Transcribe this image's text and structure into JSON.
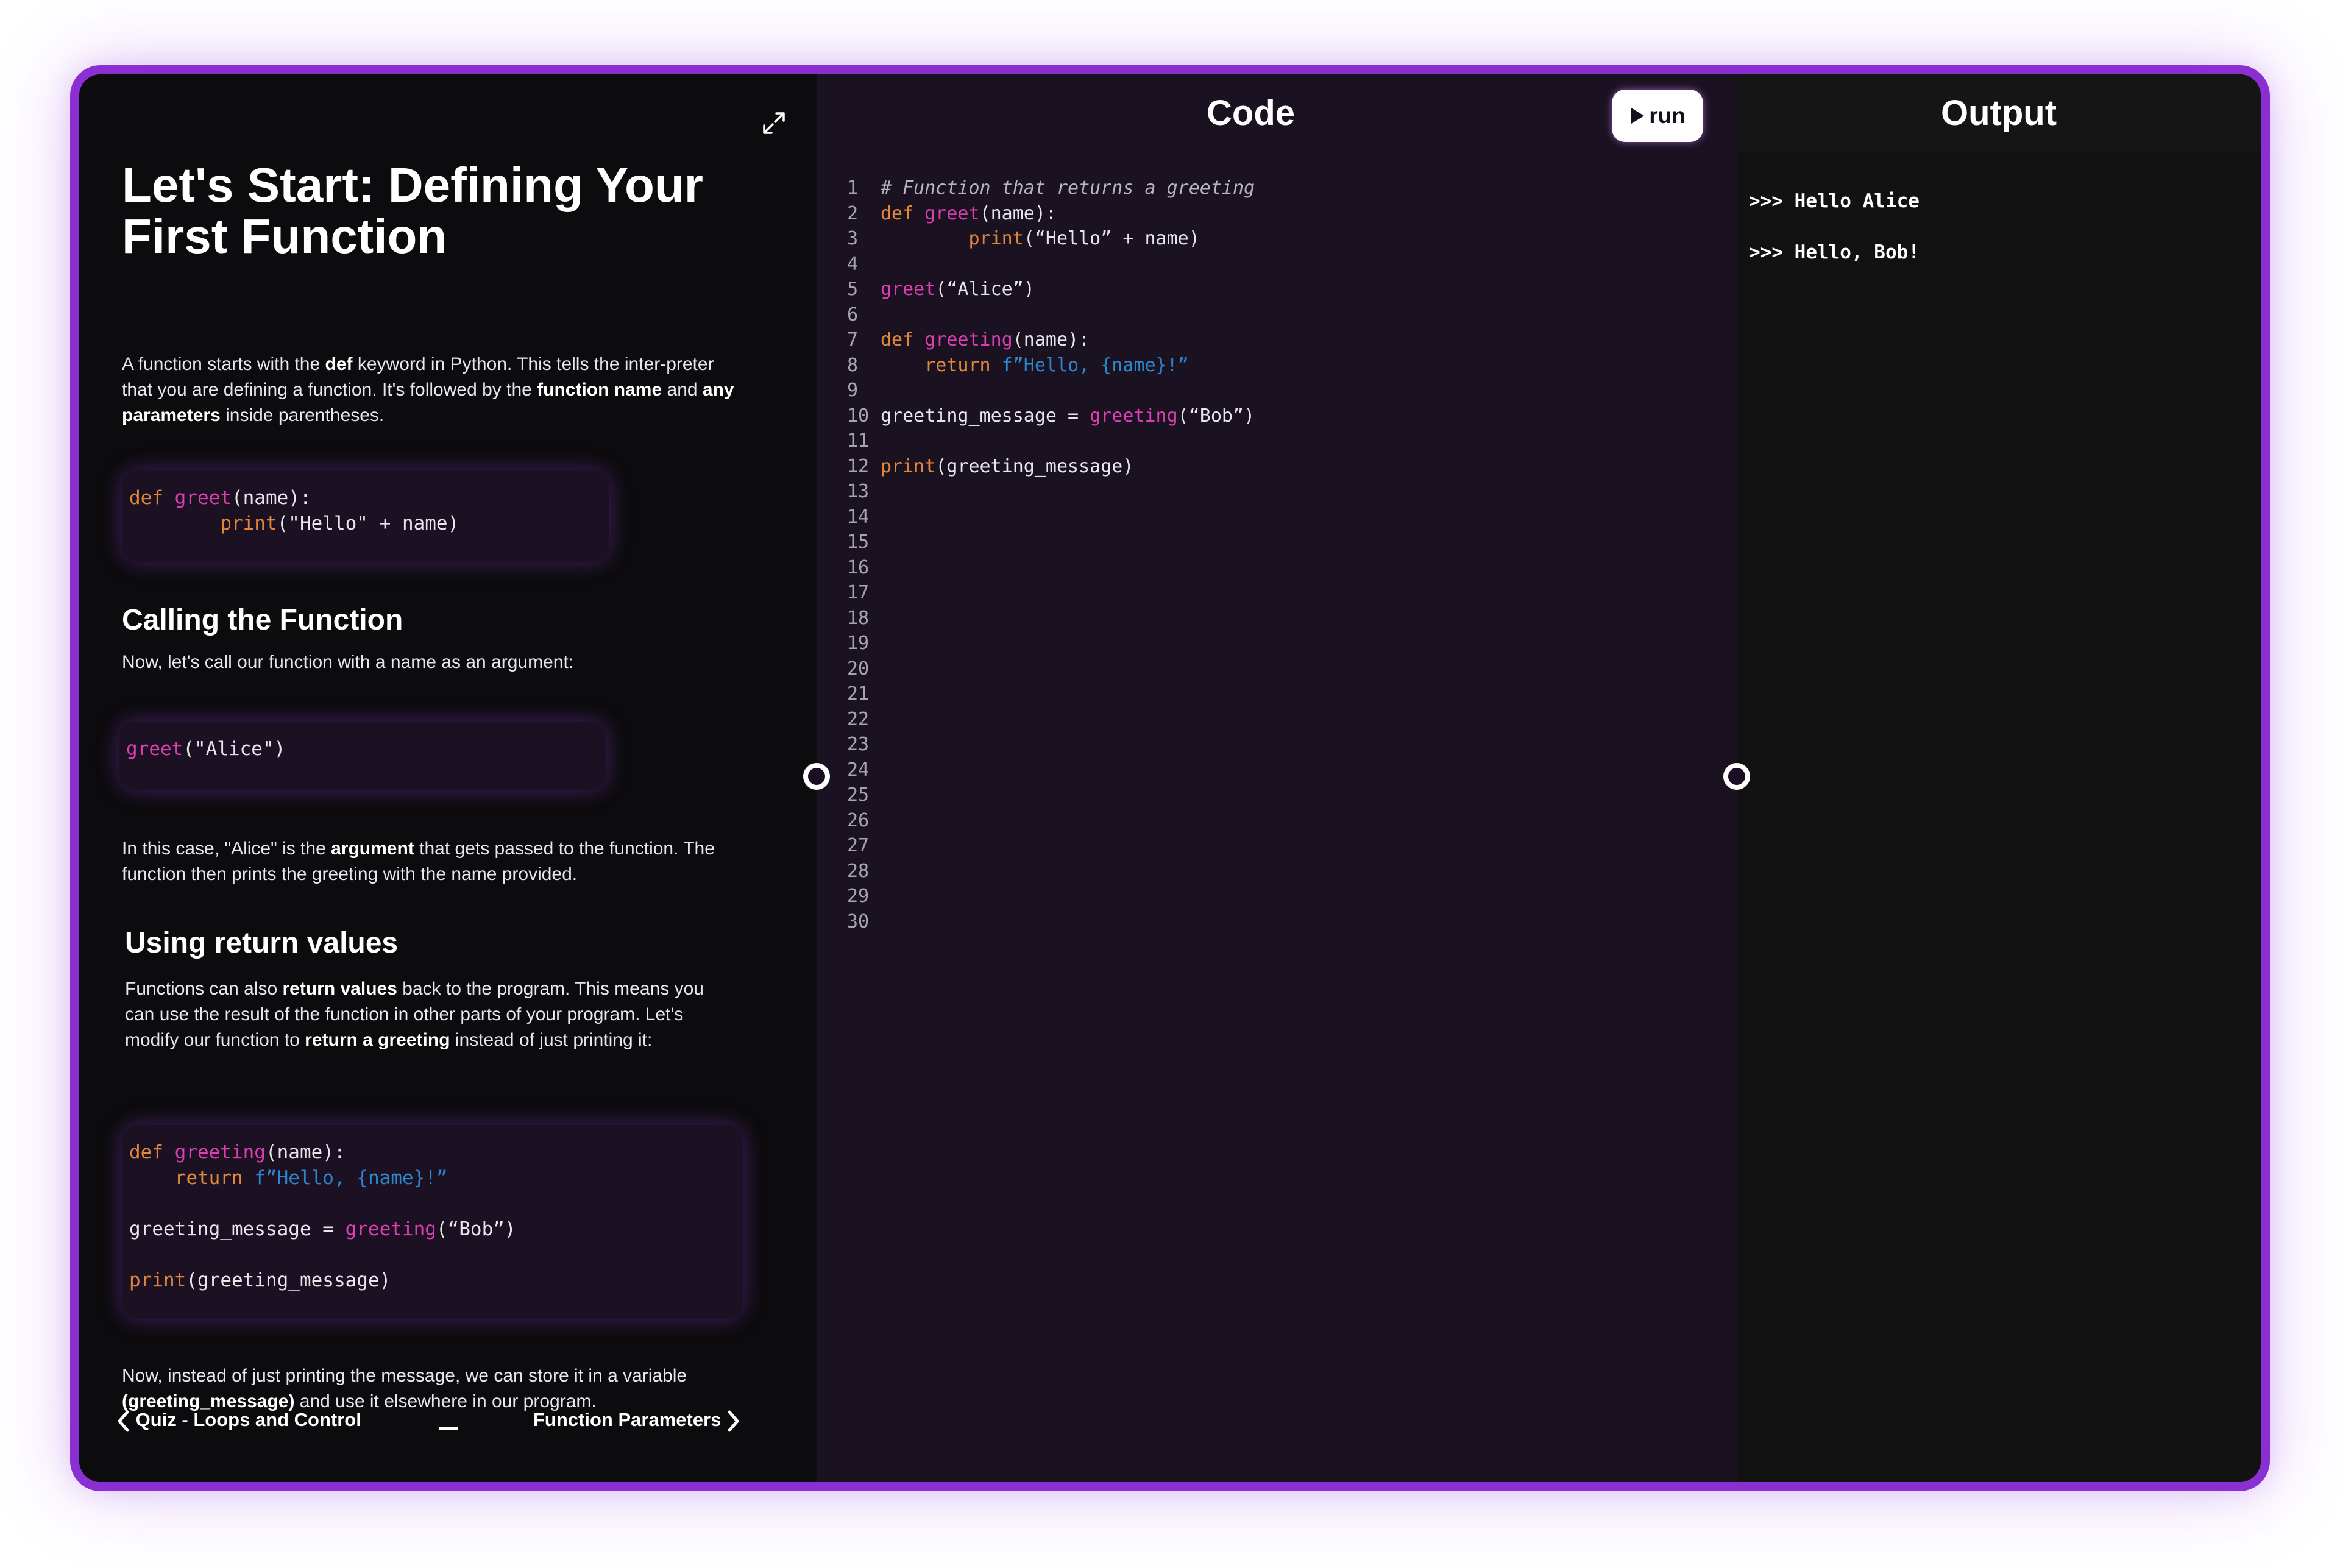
{
  "lesson": {
    "title": "Let's Start: Defining Your First Function",
    "intro": [
      {
        "t": "A function starts with the ",
        "b": false
      },
      {
        "t": "def",
        "b": true
      },
      {
        "t": " keyword in Python. This tells the inter-preter that you are defining a function. It's followed by the ",
        "b": false
      },
      {
        "t": "function name",
        "b": true
      },
      {
        "t": " and ",
        "b": false
      },
      {
        "t": "any parameters",
        "b": true
      },
      {
        "t": " inside parentheses.",
        "b": false
      }
    ],
    "section_call_title": "Calling the Function",
    "call_text": "Now, let's call our function with a name as an argument:",
    "argument_text": [
      {
        "t": "In this case, \"Alice\" is the ",
        "b": false
      },
      {
        "t": "argument",
        "b": true
      },
      {
        "t": " that gets passed to the function. The function then prints the greeting with the name provided.",
        "b": false
      }
    ],
    "section_return_title": "Using return values",
    "return_text": [
      {
        "t": "Functions can also ",
        "b": false
      },
      {
        "t": "return values",
        "b": true
      },
      {
        "t": " back to the program. This means you can use the result of the function in other parts of your program. Let's modify our function to ",
        "b": false
      },
      {
        "t": "return a greeting",
        "b": true
      },
      {
        "t": " instead of just printing it:",
        "b": false
      }
    ],
    "store_text": [
      {
        "t": "Now, instead of just printing the message, we can store it in a variable ",
        "b": false
      },
      {
        "t": "(greeting_message)",
        "b": true
      },
      {
        "t": " and use it elsewhere in our program.",
        "b": false
      }
    ],
    "snippet1": [
      [
        {
          "c": "kw",
          "t": "def "
        },
        {
          "c": "fn",
          "t": "greet"
        },
        {
          "c": "",
          "t": "(name):"
        }
      ],
      [
        {
          "c": "",
          "t": "        "
        },
        {
          "c": "kw",
          "t": "print"
        },
        {
          "c": "",
          "t": "(\"Hello\" + name)"
        }
      ]
    ],
    "snippet2": [
      [
        {
          "c": "fn",
          "t": "greet"
        },
        {
          "c": "",
          "t": "(\"Alice\")"
        }
      ]
    ],
    "snippet3": [
      [
        {
          "c": "kw",
          "t": "def "
        },
        {
          "c": "fn",
          "t": "greeting"
        },
        {
          "c": "",
          "t": "(name):"
        }
      ],
      [
        {
          "c": "",
          "t": "    "
        },
        {
          "c": "kw",
          "t": "return "
        },
        {
          "c": "st",
          "t": "f”Hello, {name}!”"
        }
      ],
      [
        {
          "c": "",
          "t": ""
        }
      ],
      [
        {
          "c": "",
          "t": "greeting_message = "
        },
        {
          "c": "fn",
          "t": "greeting"
        },
        {
          "c": "",
          "t": "(“Bob”)"
        }
      ],
      [
        {
          "c": "",
          "t": ""
        }
      ],
      [
        {
          "c": "kw",
          "t": "print"
        },
        {
          "c": "",
          "t": "(greeting_message)"
        }
      ]
    ],
    "prev_label": "Quiz - Loops and Control",
    "next_label": "Function Parameters"
  },
  "code": {
    "title": "Code",
    "run_label": "run",
    "line_count": 30,
    "lines": [
      [
        {
          "c": "cm",
          "t": "# Function that returns a greeting"
        }
      ],
      [
        {
          "c": "kw",
          "t": "def "
        },
        {
          "c": "fn",
          "t": "greet"
        },
        {
          "c": "",
          "t": "(name):"
        }
      ],
      [
        {
          "c": "",
          "t": "        "
        },
        {
          "c": "kw",
          "t": "print"
        },
        {
          "c": "",
          "t": "(“Hello” + name)"
        }
      ],
      [
        {
          "c": "",
          "t": ""
        }
      ],
      [
        {
          "c": "fn",
          "t": "greet"
        },
        {
          "c": "",
          "t": "(“Alice”)"
        }
      ],
      [
        {
          "c": "",
          "t": ""
        }
      ],
      [
        {
          "c": "kw",
          "t": "def "
        },
        {
          "c": "fn",
          "t": "greeting"
        },
        {
          "c": "",
          "t": "(name):"
        }
      ],
      [
        {
          "c": "",
          "t": "    "
        },
        {
          "c": "kw",
          "t": "return "
        },
        {
          "c": "st",
          "t": "f”Hello, {name}!”"
        }
      ],
      [
        {
          "c": "",
          "t": ""
        }
      ],
      [
        {
          "c": "",
          "t": "greeting_message = "
        },
        {
          "c": "fn",
          "t": "greeting"
        },
        {
          "c": "",
          "t": "(“Bob”)"
        }
      ],
      [
        {
          "c": "",
          "t": ""
        }
      ],
      [
        {
          "c": "kw",
          "t": "print"
        },
        {
          "c": "",
          "t": "(greeting_message)"
        }
      ]
    ]
  },
  "output": {
    "title": "Output",
    "lines": [
      ">>> Hello Alice",
      ">>> Hello, Bob!"
    ]
  },
  "colors": {
    "accent": "#8a2fd1",
    "keyword": "#e0873a",
    "function": "#dd3fb3",
    "string": "#2e86ce"
  }
}
